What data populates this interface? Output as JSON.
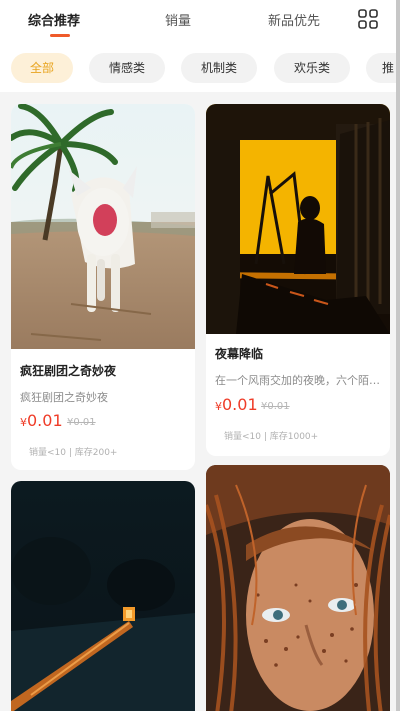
{
  "sort_tabs": [
    {
      "label": "综合推荐",
      "active": true
    },
    {
      "label": "销量",
      "active": false
    },
    {
      "label": "新品优先",
      "active": false
    }
  ],
  "grid_toggle_icon": "grid-icon",
  "categories": [
    {
      "label": "全部",
      "active": true
    },
    {
      "label": "情感类",
      "active": false
    },
    {
      "label": "机制类",
      "active": false
    },
    {
      "label": "欢乐类",
      "active": false
    },
    {
      "label": "推",
      "active": false
    }
  ],
  "colors": {
    "accent": "#ef5a2a",
    "price": "#ef3c28",
    "chip_active_bg": "#fdf0d8",
    "chip_active_text": "#e8a41f"
  },
  "products": [
    {
      "title": "疯狂剧团之奇妙夜",
      "desc": "疯狂剧团之奇妙夜",
      "currency": "¥",
      "price": "0.01",
      "old_price": "¥0.01",
      "stats": "销量<10 | 库存200+",
      "image": "white-kitten-on-beach-photo"
    },
    {
      "title": "夜幕降临",
      "desc": "在一个风雨交加的夜晚，六个陌生人",
      "currency": "¥",
      "price": "0.01",
      "old_price": "¥0.01",
      "stats": "销量<10 | 库存1000+",
      "image": "painter-silhouette-sunset-photo"
    },
    {
      "title": "",
      "desc": "",
      "image": "dark-figure-with-glowing-light-photo"
    },
    {
      "title": "",
      "desc": "",
      "image": "freckled-woman-portrait-photo"
    }
  ]
}
